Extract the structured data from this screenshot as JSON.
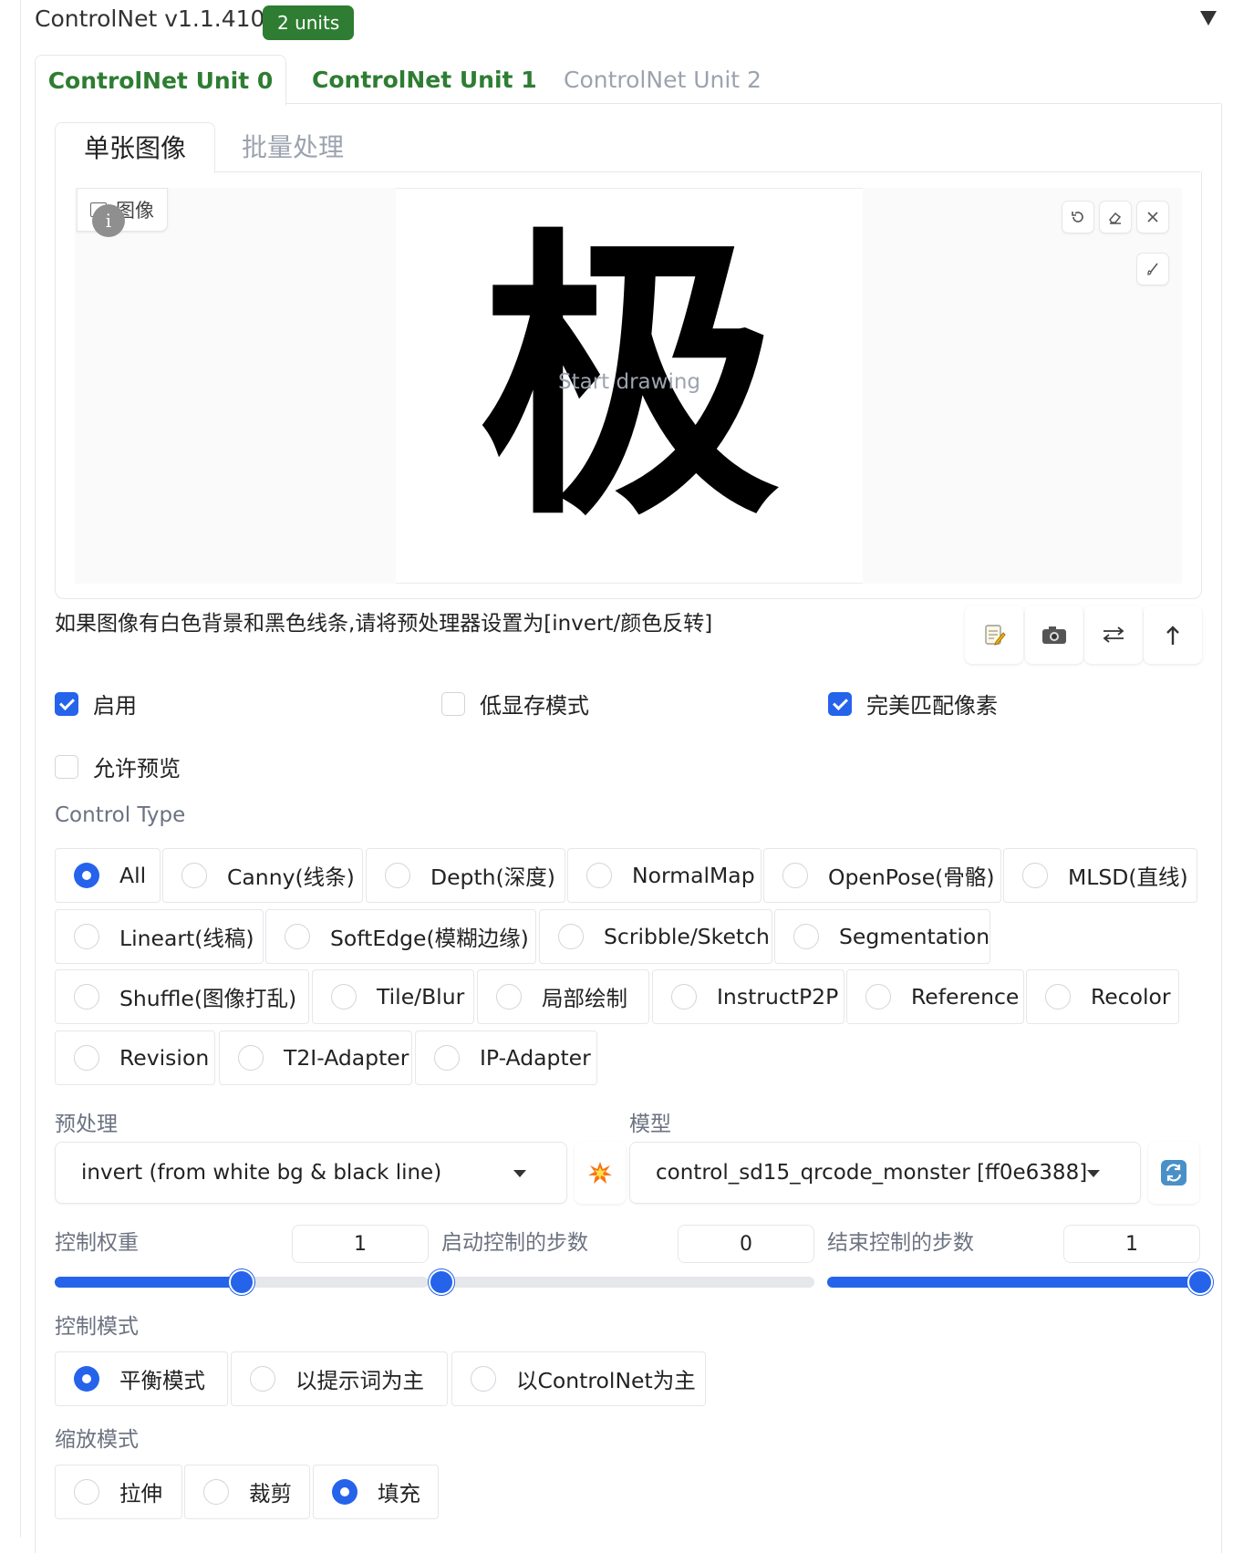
{
  "header": {
    "title": "ControlNet v1.1.410",
    "badge": "2 units"
  },
  "unit_tabs": [
    "ControlNet Unit 0",
    "ControlNet Unit 1",
    "ControlNet Unit 2"
  ],
  "mode_tabs": [
    "单张图像",
    "批量处理"
  ],
  "image_panel": {
    "label": "图像",
    "info": "i",
    "glyph": "极",
    "placeholder": "Start drawing"
  },
  "hint": "如果图像有白色背景和黑色线条,请将预处理器设置为[invert/颜色反转]",
  "action_icons": [
    "memo-icon",
    "camera-icon",
    "swap-icon",
    "upload-arrow-icon"
  ],
  "checkboxes": {
    "enable": {
      "label": "启用",
      "checked": true
    },
    "low_vram": {
      "label": "低显存模式",
      "checked": false
    },
    "pixel_perfect": {
      "label": "完美匹配像素",
      "checked": true
    },
    "allow_preview": {
      "label": "允许预览",
      "checked": false
    }
  },
  "control_type": {
    "label": "Control Type",
    "selected": "All",
    "options": [
      "All",
      "Canny(线条)",
      "Depth(深度)",
      "NormalMap",
      "OpenPose(骨骼)",
      "MLSD(直线)",
      "Lineart(线稿)",
      "SoftEdge(模糊边缘)",
      "Scribble/Sketch",
      "Segmentation",
      "Shuffle(图像打乱)",
      "Tile/Blur",
      "局部绘制",
      "InstructP2P",
      "Reference",
      "Recolor",
      "Revision",
      "T2I-Adapter",
      "IP-Adapter"
    ]
  },
  "preprocessor": {
    "label": "预处理",
    "value": "invert (from white bg & black line)",
    "run_icon": "explosion-icon"
  },
  "model": {
    "label": "模型",
    "value": "control_sd15_qrcode_monster [ff0e6388]",
    "refresh_icon": "refresh-icon"
  },
  "sliders": {
    "weight": {
      "label": "控制权重",
      "value": "1",
      "fraction": 0.5
    },
    "start": {
      "label": "启动控制的步数",
      "value": "0",
      "fraction": 0.0
    },
    "end": {
      "label": "结束控制的步数",
      "value": "1",
      "fraction": 1.0
    }
  },
  "control_mode": {
    "label": "控制模式",
    "selected": "平衡模式",
    "options": [
      "平衡模式",
      "以提示词为主",
      "以ControlNet为主"
    ]
  },
  "resize_mode": {
    "label": "缩放模式",
    "selected": "填充",
    "options": [
      "拉伸",
      "裁剪",
      "填充"
    ]
  },
  "colors": {
    "accent": "#2563eb",
    "brand_green": "#2e7d32",
    "border": "#e5e7eb",
    "muted": "#9ca3af"
  }
}
